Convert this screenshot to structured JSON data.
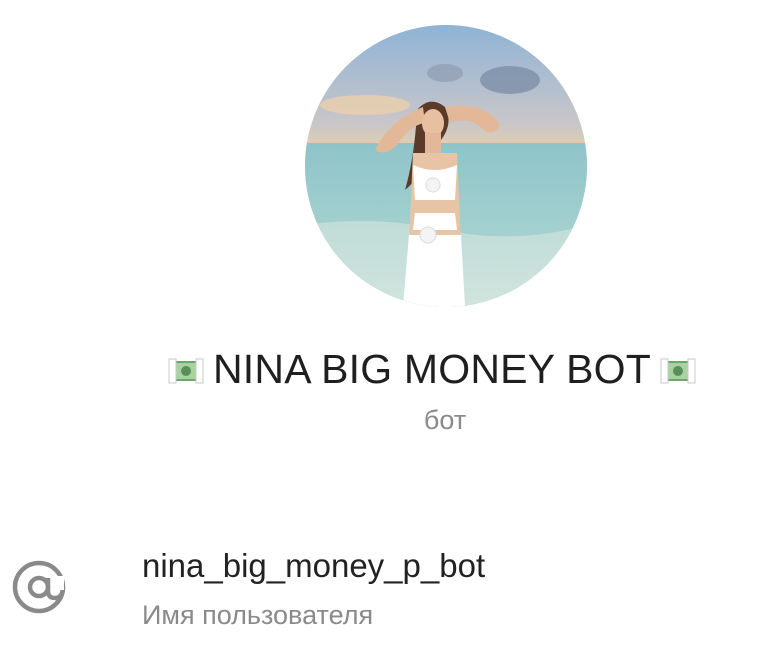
{
  "profile": {
    "name": "NINA BIG MONEY BOT",
    "type_label": "бот",
    "avatar_icon": "profile-photo",
    "name_emoji": "money-with-wings-icon"
  },
  "username": {
    "value": "nina_big_money_p_bot",
    "label": "Имя пользователя",
    "icon": "at-sign-icon"
  }
}
